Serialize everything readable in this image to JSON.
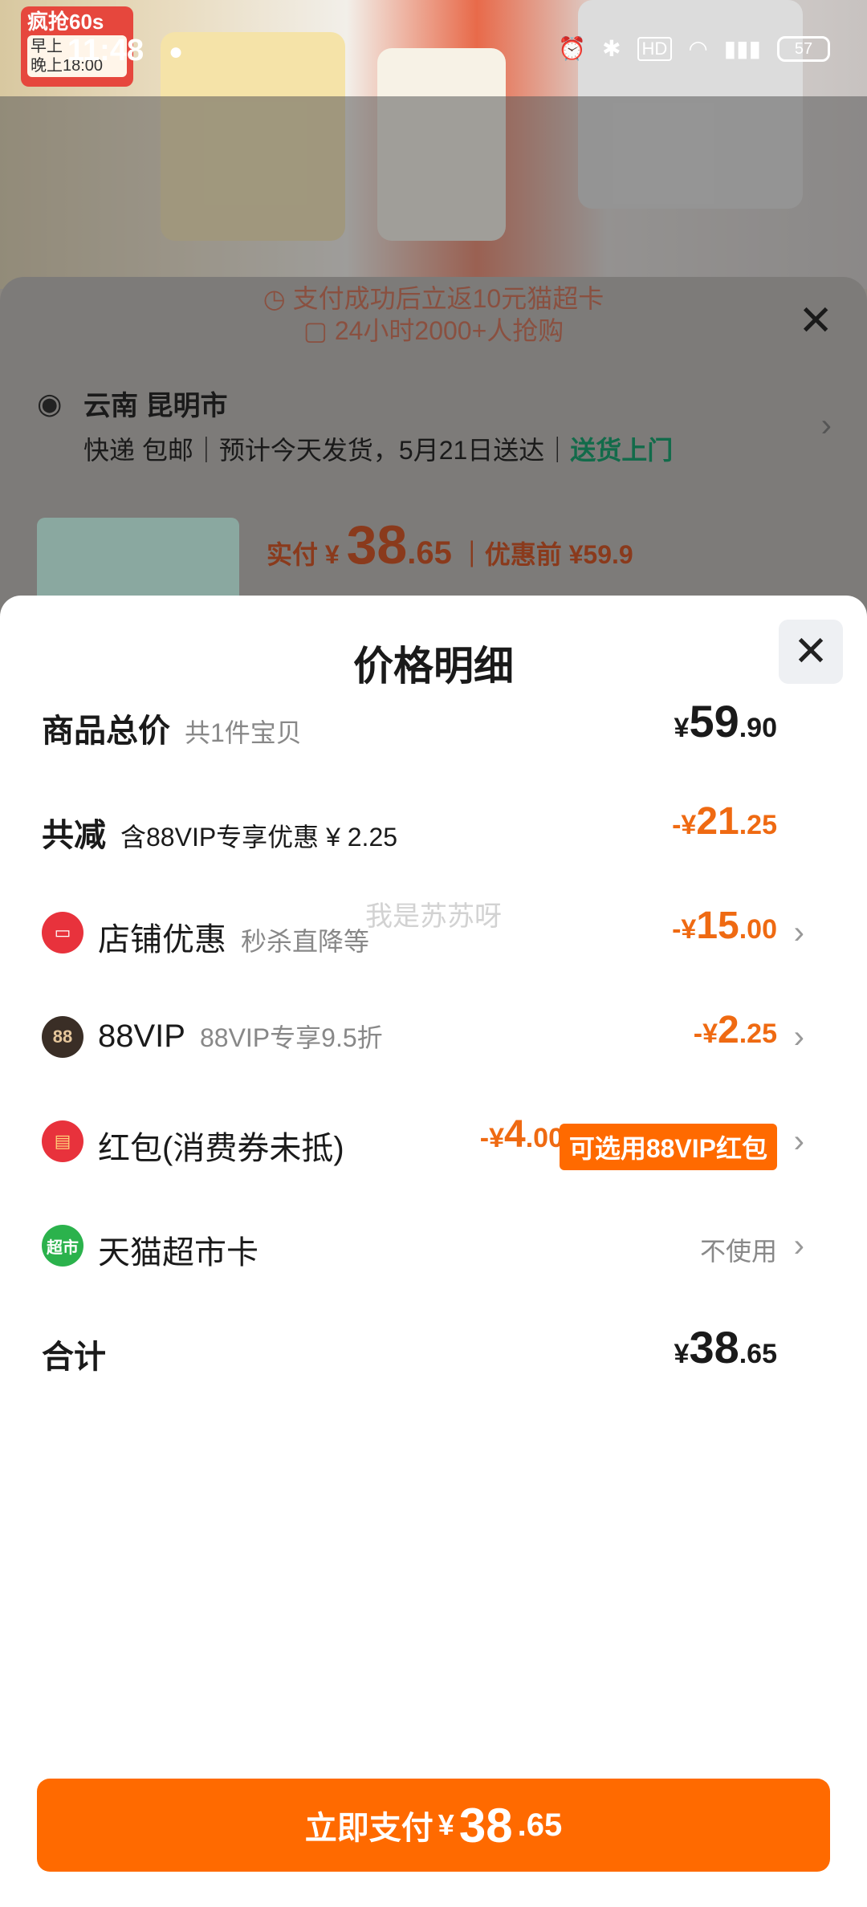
{
  "status_bar": {
    "time": "11:48",
    "promo_title": "疯抢60s",
    "promo_line1": "早上",
    "promo_line2": "晚上18:00",
    "battery": "57"
  },
  "background_panel": {
    "banner_line1": "支付成功后立返10元猫超卡",
    "banner_line2": "24小时2000+人抢购",
    "city": "云南 昆明市",
    "delivery_text": "快递 包邮｜预计今天发货，5月21日送达｜",
    "delivery_highlight": "送货上门",
    "pay_label": "实付",
    "pay_currency": "¥",
    "pay_int": "38",
    "pay_dec": ".65",
    "before_label": "｜优惠前 ¥59.9"
  },
  "sheet": {
    "title": "价格明细",
    "watermark": "我是苏苏呀",
    "rows": [
      {
        "label": "商品总价",
        "sub": "共1件宝贝",
        "currency": "¥",
        "int": "59",
        "dec": ".90"
      },
      {
        "label": "共减",
        "sub": "含88VIP专享优惠 ¥ 2.25",
        "currency": "-¥",
        "int": "21",
        "dec": ".25"
      },
      {
        "label": "店铺优惠",
        "sub": "秒杀直降等",
        "currency": "-¥",
        "int": "15",
        "dec": ".00",
        "icon_text": ""
      },
      {
        "label": "88VIP",
        "sub": "88VIP专享9.5折",
        "currency": "-¥",
        "int": "2",
        "dec": ".25",
        "icon_text": "88"
      },
      {
        "label": "红包(消费券未抵)",
        "currency": "-¥",
        "int": "4",
        "dec": ".00",
        "badge": "可选用88VIP红包"
      },
      {
        "label": "天猫超市卡",
        "status": "不使用",
        "icon_text": "超市"
      },
      {
        "label": "合计",
        "currency": "¥",
        "int": "38",
        "dec": ".65"
      }
    ],
    "pay_button": {
      "label": "立即支付",
      "currency": "¥",
      "int": "38",
      "dec": ".65"
    }
  },
  "colors": {
    "accent": "#ff6a00",
    "discount": "#ef6a12",
    "green": "#126b4a"
  }
}
